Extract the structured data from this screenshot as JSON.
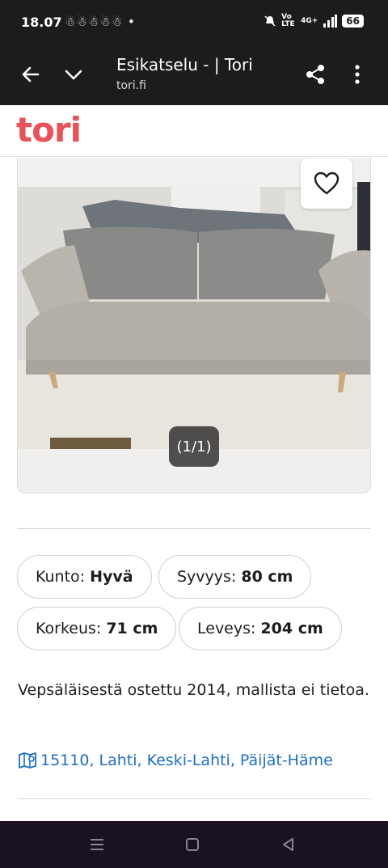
{
  "status_bar": {
    "time": "18.07",
    "notifications": "☃☃☃☃☃ •",
    "network": "4G+",
    "volte": "Vo LTE",
    "battery": "66"
  },
  "browser": {
    "title": "Esikatselu - | Tori",
    "url": "tori.fi"
  },
  "site": {
    "logo": "tori"
  },
  "gallery": {
    "counter": "(1/1)"
  },
  "attributes": [
    {
      "label": "Kunto:",
      "value": "Hyvä"
    },
    {
      "label": "Syvyys:",
      "value": "80 cm"
    },
    {
      "label": "Korkeus:",
      "value": "71 cm"
    },
    {
      "label": "Leveys:",
      "value": "204 cm"
    }
  ],
  "description": "Vepsäläisestä ostettu 2014, mallista ei tietoa.",
  "location": "15110, Lahti, Keski-Lahti, Päijät-Häme",
  "icons": {
    "back": "arrow-left-icon",
    "collapse": "chevron-down-icon",
    "share": "share-icon",
    "menu": "more-vert-icon",
    "favorite": "heart-icon",
    "map": "map-icon"
  }
}
